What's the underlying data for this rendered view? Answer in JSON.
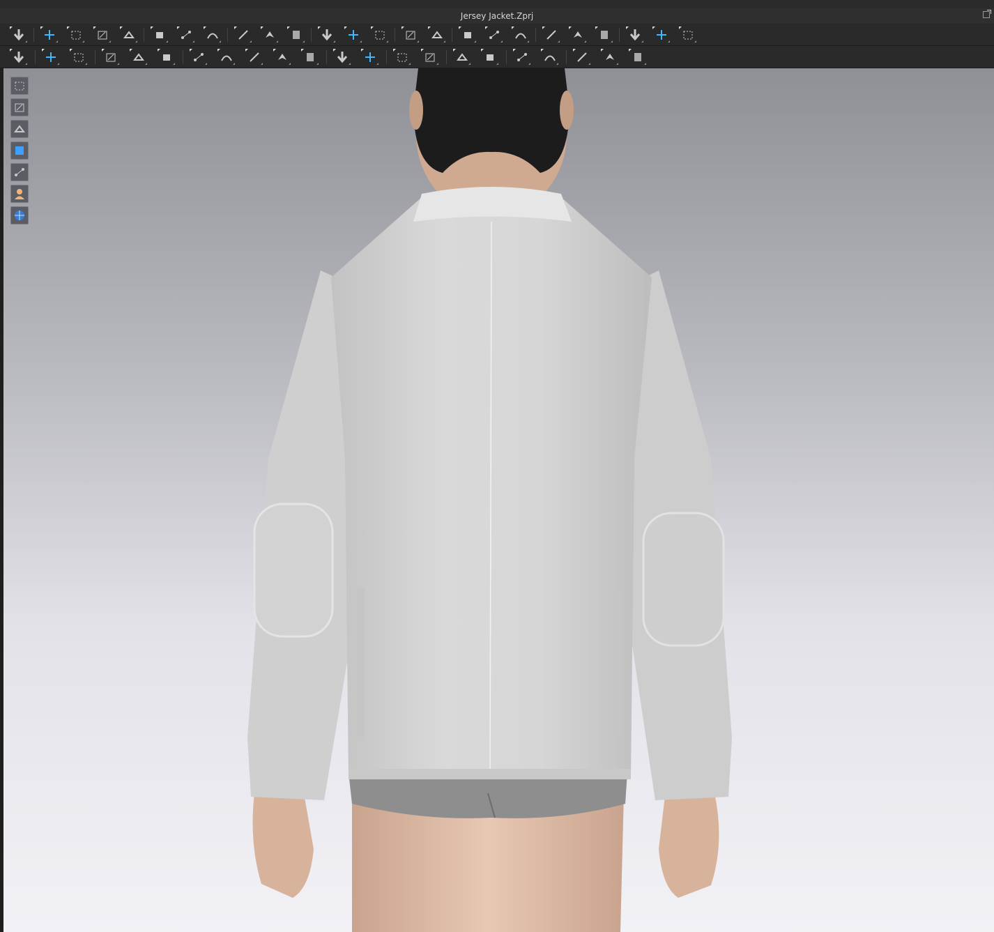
{
  "window": {
    "title": "Jersey Jacket.Zprj"
  },
  "colors": {
    "icon": "#c9c9c9",
    "icon_accent": "#3fb8ff",
    "toolbar_bg": "#2a2a2a",
    "jacket": "#d6d6d6",
    "underwear": "#8a8a8a",
    "hair": "#1c1c1c",
    "skin": "#d9b59e",
    "viewport_top": "#8f9096",
    "viewport_bottom": "#f1f1f6"
  },
  "toolbar_top": [
    {
      "icon": "simulation-icon"
    },
    {
      "icon": "select-move-icon"
    },
    {
      "icon": "box-select-icon"
    },
    {
      "icon": "transform-pattern-icon"
    },
    {
      "icon": "fold-arrangement-icon"
    },
    {
      "icon": "edit-pattern-icon"
    },
    {
      "icon": "edit-curvature-icon"
    },
    {
      "icon": "edit-sewing-icon"
    },
    {
      "icon": "segment-sewing-icon"
    },
    {
      "icon": "free-sewing-icon"
    },
    {
      "icon": "tack-icon"
    },
    {
      "icon": "fold-icon"
    },
    {
      "icon": "show-arrangement-points-icon"
    },
    {
      "icon": "strengthen-icon"
    },
    {
      "icon": "avatar-pose-icon"
    },
    {
      "icon": "garment-fit-icon"
    },
    {
      "icon": "shrink-icon"
    },
    {
      "icon": "expand-icon"
    },
    {
      "icon": "layer-up-icon"
    },
    {
      "icon": "layer-down-icon"
    },
    {
      "icon": "pin-icon"
    },
    {
      "icon": "pin-box-icon"
    },
    {
      "icon": "measure-circumference-icon"
    },
    {
      "icon": "tape-measure-icon"
    },
    {
      "icon": "ruler-icon"
    }
  ],
  "toolbar_bottom": [
    {
      "icon": "avatar-walk-icon"
    },
    {
      "icon": "edit-texture-icon"
    },
    {
      "icon": "transform-graphic-icon"
    },
    {
      "icon": "puckering-icon"
    },
    {
      "icon": "fold-line-icon"
    },
    {
      "icon": "edit-pleat-icon"
    },
    {
      "icon": "button-icon"
    },
    {
      "icon": "buttonhole-icon"
    },
    {
      "icon": "topstitch-icon"
    },
    {
      "icon": "buttonhole-add-icon"
    },
    {
      "icon": "fasten-button-icon"
    },
    {
      "icon": "line-icon"
    },
    {
      "icon": "lock-icon"
    },
    {
      "icon": "zipper-icon"
    },
    {
      "icon": "edit-zipper-icon"
    },
    {
      "icon": "tape-icon"
    },
    {
      "icon": "edit-tape-icon"
    },
    {
      "icon": "pattern-fill-icon"
    },
    {
      "icon": "compress-icon"
    },
    {
      "icon": "garment-up-icon"
    },
    {
      "icon": "garment-down-icon"
    },
    {
      "icon": "fur-icon"
    }
  ],
  "viewport_tools": [
    {
      "icon": "show-garment-icon"
    },
    {
      "icon": "show-pattern-icon"
    },
    {
      "icon": "show-avatar-icon"
    },
    {
      "icon": "texture-view-icon"
    },
    {
      "icon": "mesh-view-icon"
    },
    {
      "icon": "avatar-skin-icon"
    },
    {
      "icon": "environment-globe-icon"
    }
  ]
}
